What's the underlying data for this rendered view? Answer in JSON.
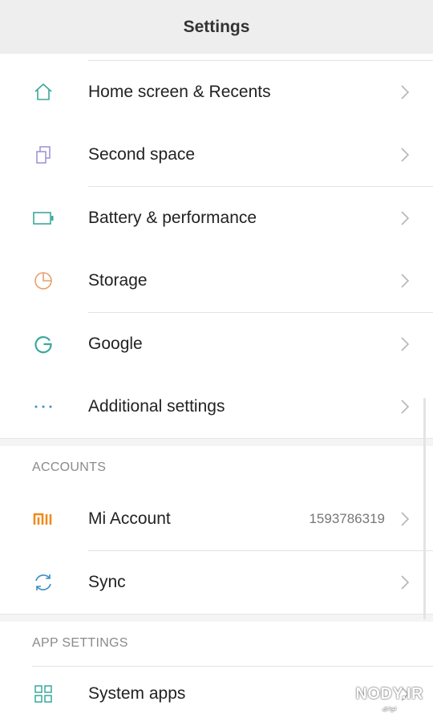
{
  "header": {
    "title": "Settings"
  },
  "items_top": [
    {
      "label": "Home screen & Recents",
      "icon": "home-icon",
      "color": "#3aa89b"
    },
    {
      "label": "Second space",
      "icon": "copy-windows-icon",
      "color": "#9b8fd6"
    },
    {
      "label": "Battery & performance",
      "icon": "battery-icon",
      "color": "#3aa89b"
    },
    {
      "label": "Storage",
      "icon": "pie-chart-icon",
      "color": "#e8a06c"
    },
    {
      "label": "Google",
      "icon": "google-g-icon",
      "color": "#3aa89b"
    },
    {
      "label": "Additional settings",
      "icon": "more-dots-icon",
      "color": "#3b8fc6"
    }
  ],
  "accounts": {
    "header": "ACCOUNTS",
    "items": [
      {
        "label": "Mi Account",
        "value": "1593786319",
        "icon": "mi-logo-icon",
        "color": "#f08a1c"
      },
      {
        "label": "Sync",
        "icon": "sync-icon",
        "color": "#3b8fc6"
      }
    ]
  },
  "app_settings": {
    "header": "APP SETTINGS",
    "items": [
      {
        "label": "System apps",
        "icon": "grid-apps-icon",
        "color": "#3aa89b"
      }
    ]
  },
  "watermark": {
    "text": "NODY.IR",
    "subtext": "نودی"
  }
}
